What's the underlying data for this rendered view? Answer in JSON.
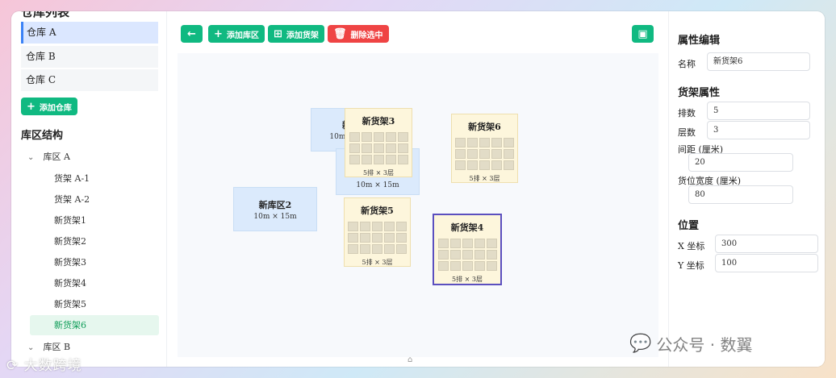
{
  "warehouse_panel": {
    "title": "仓库列表",
    "warehouses": [
      "仓库 A",
      "仓库 B",
      "仓库 C"
    ],
    "active_index": 0,
    "add_label": "添加仓库"
  },
  "structure": {
    "title": "库区结构",
    "zone_a": "库区 A",
    "zone_a_items": [
      "货架 A-1",
      "货架 A-2",
      "新货架1",
      "新货架2",
      "新货架3",
      "新货架4",
      "新货架5",
      "新货架6"
    ],
    "selected_item": "新货架6",
    "zone_b": "库区 B"
  },
  "toolbar": {
    "back_icon": "arrow-left-icon",
    "add_zone_label": "添加库区",
    "add_shelf_label": "添加货架",
    "delete_label": "删除选中",
    "save_icon": "save-icon"
  },
  "canvas": {
    "zones": [
      {
        "id": "zone-hidden",
        "name": "新库",
        "size": "10m × 15m"
      },
      {
        "id": "zone-center",
        "name": "",
        "size": "10m × 15m"
      },
      {
        "id": "zone-2",
        "name": "新库区2",
        "size": "10m × 15m"
      }
    ],
    "shelves": [
      {
        "id": "shelf-3",
        "name": "新货架3",
        "info": "5排 × 3层",
        "rows": 3,
        "cols": 5
      },
      {
        "id": "shelf-6",
        "name": "新货架6",
        "info": "5排 × 3层",
        "rows": 3,
        "cols": 5
      },
      {
        "id": "shelf-5",
        "name": "新货架5",
        "info": "5排 × 3层",
        "rows": 3,
        "cols": 5
      },
      {
        "id": "shelf-4",
        "name": "新货架4",
        "info": "5排 × 3层",
        "rows": 3,
        "cols": 5,
        "selected": true
      }
    ]
  },
  "properties": {
    "title": "属性编辑",
    "name_label": "名称",
    "name_value": "新货架6",
    "shelf_title": "货架属性",
    "rows_label": "排数",
    "rows_value": "5",
    "levels_label": "层数",
    "levels_value": "3",
    "spacing_label": "间距 (厘米)",
    "spacing_value": "20",
    "slot_width_label": "货位宽度 (厘米)",
    "slot_width_value": "80",
    "position_title": "位置",
    "x_label": "X 坐标",
    "x_value": "300",
    "y_label": "Y 坐标",
    "y_value": "100"
  },
  "watermarks": {
    "left": "大数跨境",
    "right": "公众号 · 数翼"
  },
  "colors": {
    "primary_green": "#10b981",
    "danger_red": "#ef4444",
    "zone_fill": "#dbeafc",
    "shelf_fill": "#fdf6dc",
    "selected_border": "#5b4fbf"
  }
}
